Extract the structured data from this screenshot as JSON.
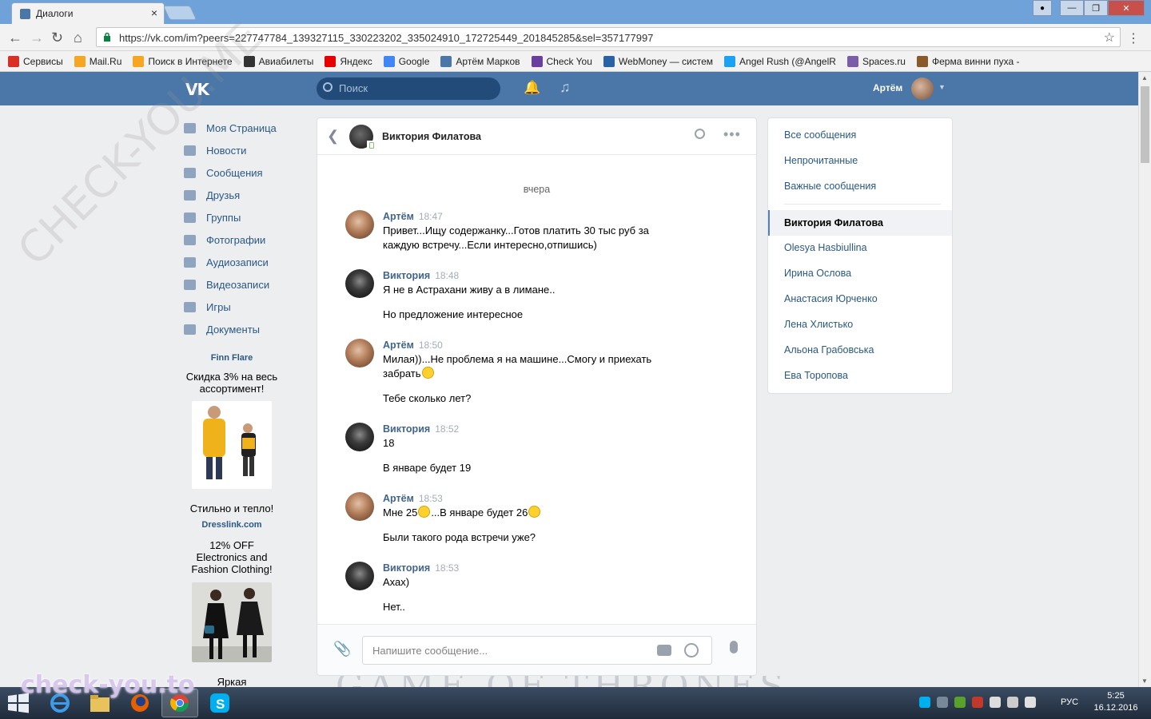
{
  "browser": {
    "tab_title": "Диалоги",
    "tab_close": "×",
    "url": "https://vk.com/im?peers=227747784_139327115_330223202_335024910_172725449_201845285&sel=357177997",
    "bookmarks": [
      {
        "label": "Сервисы",
        "color": "#d93025"
      },
      {
        "label": "Mail.Ru",
        "color": "#f5a623"
      },
      {
        "label": "Поиск в Интернете",
        "color": "#f5a623"
      },
      {
        "label": "Авиабилеты",
        "color": "#333333"
      },
      {
        "label": "Яндекс",
        "color": "#e60000"
      },
      {
        "label": "Google",
        "color": "#4285f4"
      },
      {
        "label": "Артём Марков",
        "color": "#4a76a8"
      },
      {
        "label": "Check You",
        "color": "#6b3fa0"
      },
      {
        "label": "WebMoney — систем",
        "color": "#2a62a8"
      },
      {
        "label": "Angel Rush (@AngelR",
        "color": "#1da1f2"
      },
      {
        "label": "Spaces.ru",
        "color": "#7b5ea7"
      },
      {
        "label": "Ферма винни пуха -",
        "color": "#8b5a2b"
      }
    ]
  },
  "vk": {
    "logo": "VK",
    "search_placeholder": "Поиск",
    "user_name": "Артём"
  },
  "left_menu": [
    "Моя Страница",
    "Новости",
    "Сообщения",
    "Друзья",
    "Группы",
    "Фотографии",
    "Аудиозаписи",
    "Видеозаписи",
    "Игры",
    "Документы"
  ],
  "ads": [
    {
      "title": "Finn Flare",
      "text": "Скидка 3% на весь ассортимент!",
      "caption": "Стильно и тепло!"
    },
    {
      "title": "Dresslink.com",
      "text": "12% OFF Electronics and Fashion Clothing!",
      "caption": "Яркая"
    }
  ],
  "chat": {
    "contact_name": "Виктория Филатова",
    "day_separator": "вчера",
    "messages": [
      {
        "author": "Артём",
        "time": "18:47",
        "lines": [
          "Привет...Ищу содержанку...Готов платить 30 тыс руб за",
          "каждую встречу...Если интересно,отпишись)"
        ]
      },
      {
        "author": "Виктория",
        "time": "18:48",
        "lines": [
          "Я не в Астрахани живу а в лимане..",
          "Но предложение интересное"
        ]
      },
      {
        "author": "Артём",
        "time": "18:50",
        "lines": [
          "Милая))...Не проблема я на машине...Смогу и приехать",
          "забрать",
          "Тебе сколько лет?"
        ]
      },
      {
        "author": "Виктория",
        "time": "18:52",
        "lines": [
          "18",
          "В январе будет 19"
        ]
      },
      {
        "author": "Артём",
        "time": "18:53",
        "lines": [
          "Мне 25",
          "...В январе будет 26",
          "Были такого рода встречи уже?"
        ]
      },
      {
        "author": "Виктория",
        "time": "18:53",
        "lines": [
          "Ахах)",
          "Нет.."
        ]
      }
    ],
    "composer_placeholder": "Напишите сообщение..."
  },
  "right_panel": {
    "filters": [
      "Все сообщения",
      "Непрочитанные",
      "Важные сообщения"
    ],
    "active_dialog": "Виктория Филатова",
    "dialogs": [
      "Olesya Hasbiullina",
      "Ирина Ослова",
      "Анастасия Юрченко",
      "Лена Хлистько",
      "Альона Грабовська",
      "Ева Торопова"
    ]
  },
  "taskbar": {
    "language": "РУС",
    "time": "5:25",
    "date": "16.12.2016"
  },
  "watermark": {
    "diagonal": "CHECK-YOU.ME",
    "bottom": "check-you.to"
  },
  "background_text": "GAME OF THRONES",
  "colors": {
    "vk_blue": "#4a76a8",
    "link": "#2a5885",
    "author": "#42648b"
  }
}
